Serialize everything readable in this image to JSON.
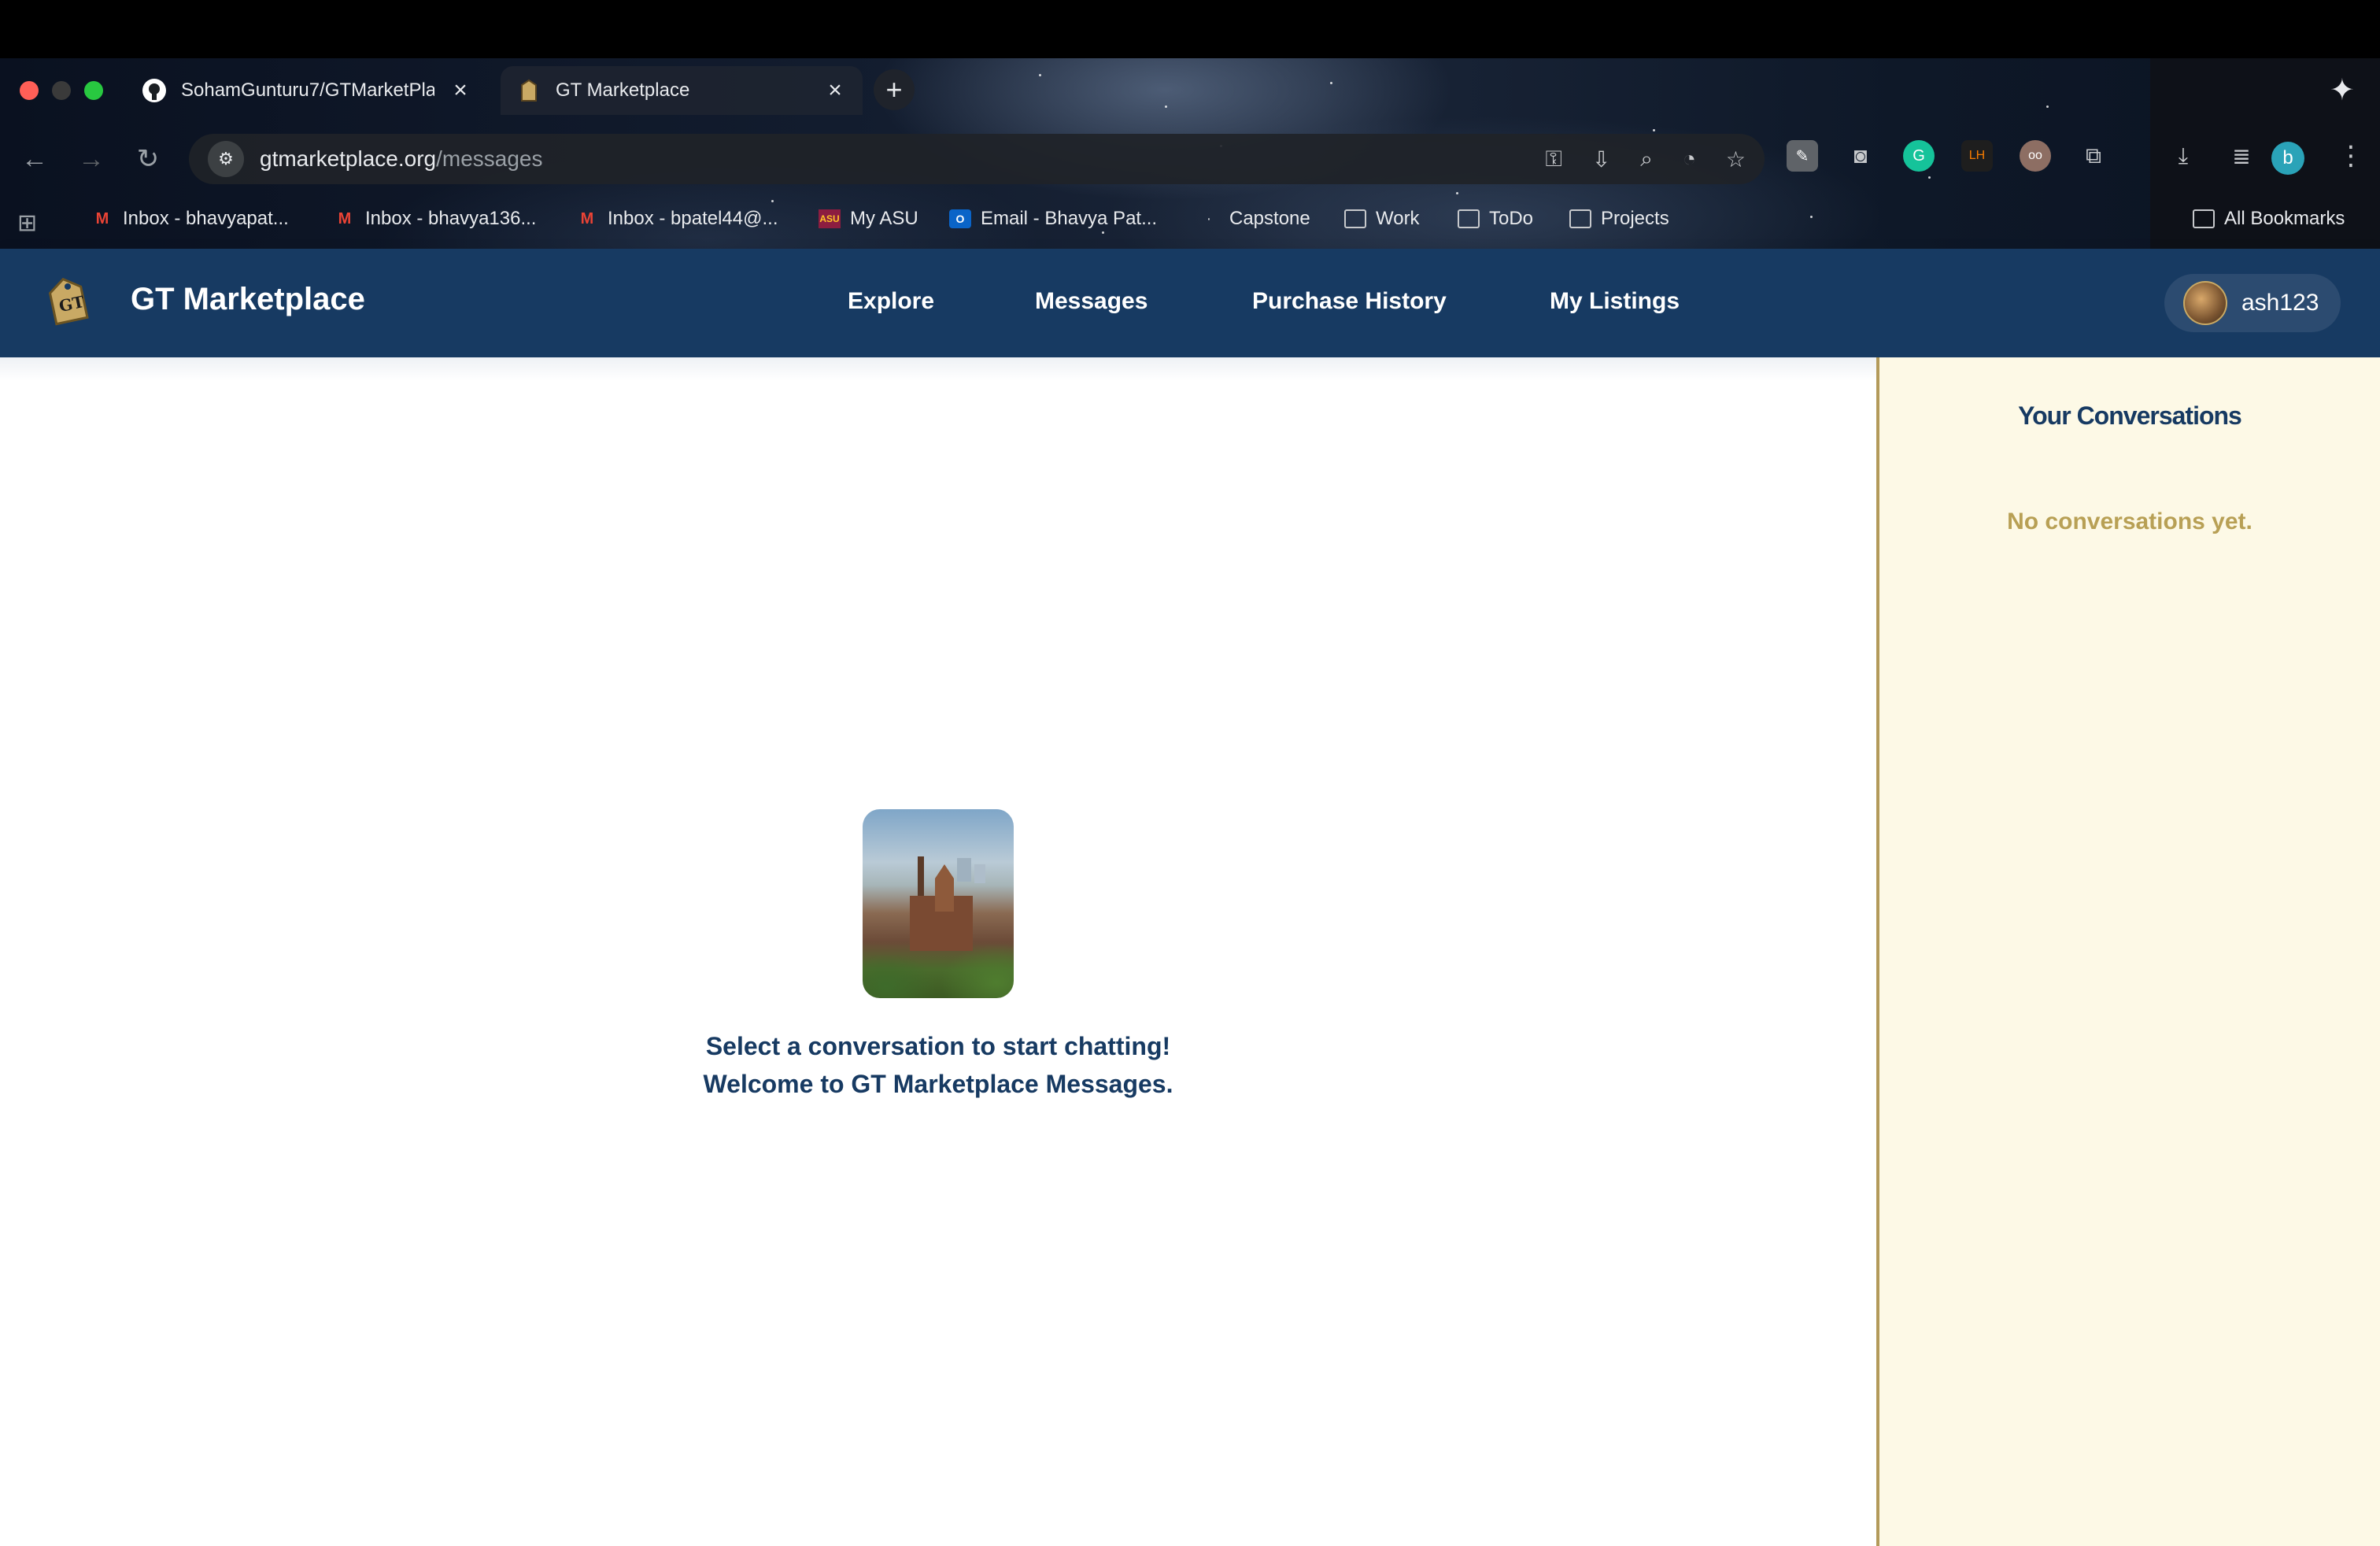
{
  "browser": {
    "tabs": [
      {
        "title": "SohamGunturu7/GTMarketPla",
        "active": false
      },
      {
        "title": "GT Marketplace",
        "active": true
      }
    ],
    "url_host": "gtmarketplace.org",
    "url_path": "/messages",
    "profile_initial": "b",
    "bookmarks": [
      {
        "label": "Inbox - bhavyapat...",
        "icon": "gmail-icon"
      },
      {
        "label": "Inbox - bhavya136...",
        "icon": "gmail-icon"
      },
      {
        "label": "Inbox - bpatel44@...",
        "icon": "gmail-icon"
      },
      {
        "label": "My ASU",
        "icon": "asu-icon"
      },
      {
        "label": "Email - Bhavya Pat...",
        "icon": "outlook-icon"
      },
      {
        "label": "Capstone",
        "icon": "bookmark-icon"
      },
      {
        "label": "Work",
        "icon": "folder-icon"
      },
      {
        "label": "ToDo",
        "icon": "folder-icon"
      },
      {
        "label": "Projects",
        "icon": "folder-icon"
      }
    ],
    "all_bookmarks": "All Bookmarks"
  },
  "header": {
    "brand": "GT Marketplace",
    "nav": [
      "Explore",
      "Messages",
      "Purchase History",
      "My Listings"
    ],
    "username": "ash123"
  },
  "main": {
    "line1": "Select a conversation to start chatting!",
    "line2": "Welcome to GT Marketplace Messages."
  },
  "sidebar": {
    "title": "Your Conversations",
    "empty_text": "No conversations yet."
  },
  "colors": {
    "header_bg": "#173a62",
    "sidebar_bg": "#fdf9e6",
    "sidebar_border": "#b39a5a",
    "empty_text": "#b8a055"
  }
}
